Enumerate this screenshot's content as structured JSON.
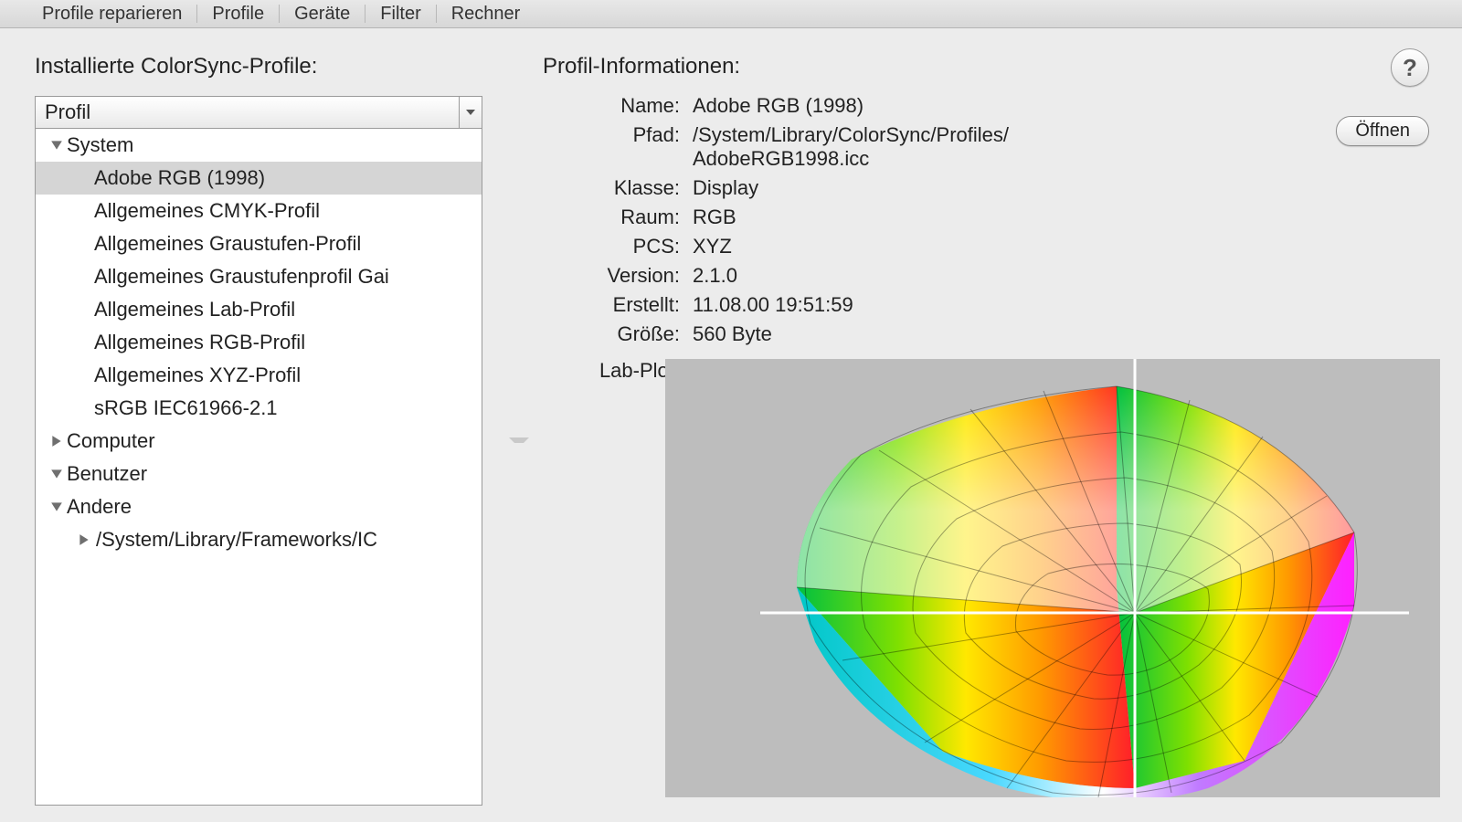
{
  "menubar": {
    "items": [
      "Profile reparieren",
      "Profile",
      "Geräte",
      "Filter",
      "Rechner"
    ]
  },
  "left": {
    "heading": "Installierte ColorSync-Profile:",
    "header_label": "Profil",
    "tree": [
      {
        "label": "System",
        "expanded": true,
        "children": [
          {
            "label": "Adobe RGB (1998)",
            "selected": true
          },
          {
            "label": "Allgemeines CMYK-Profil"
          },
          {
            "label": "Allgemeines Graustufen-Profil"
          },
          {
            "label": "Allgemeines Graustufenprofil Gai"
          },
          {
            "label": "Allgemeines Lab-Profil"
          },
          {
            "label": "Allgemeines RGB-Profil"
          },
          {
            "label": "Allgemeines XYZ-Profil"
          },
          {
            "label": "sRGB IEC61966-2.1"
          }
        ]
      },
      {
        "label": "Computer",
        "expanded": false
      },
      {
        "label": "Benutzer",
        "expanded": true
      },
      {
        "label": "Andere",
        "expanded": true,
        "children": [
          {
            "label": "/System/Library/Frameworks/IC",
            "expanded": false,
            "hasChildren": true
          }
        ]
      }
    ]
  },
  "right": {
    "heading": "Profil-Informationen:",
    "open_button": "Öffnen",
    "labels": {
      "name": "Name:",
      "path": "Pfad:",
      "class": "Klasse:",
      "space": "Raum:",
      "pcs": "PCS:",
      "version": "Version:",
      "created": "Erstellt:",
      "size": "Größe:",
      "labplot": "Lab-Plot:"
    },
    "values": {
      "name": "Adobe RGB (1998)",
      "path": "/System/Library/ColorSync/Profiles/AdobeRGB1998.icc",
      "class": "Display",
      "space": "RGB",
      "pcs": "XYZ",
      "version": "2.1.0",
      "created": "11.08.00 19:51:59",
      "size": "560 Byte"
    }
  }
}
